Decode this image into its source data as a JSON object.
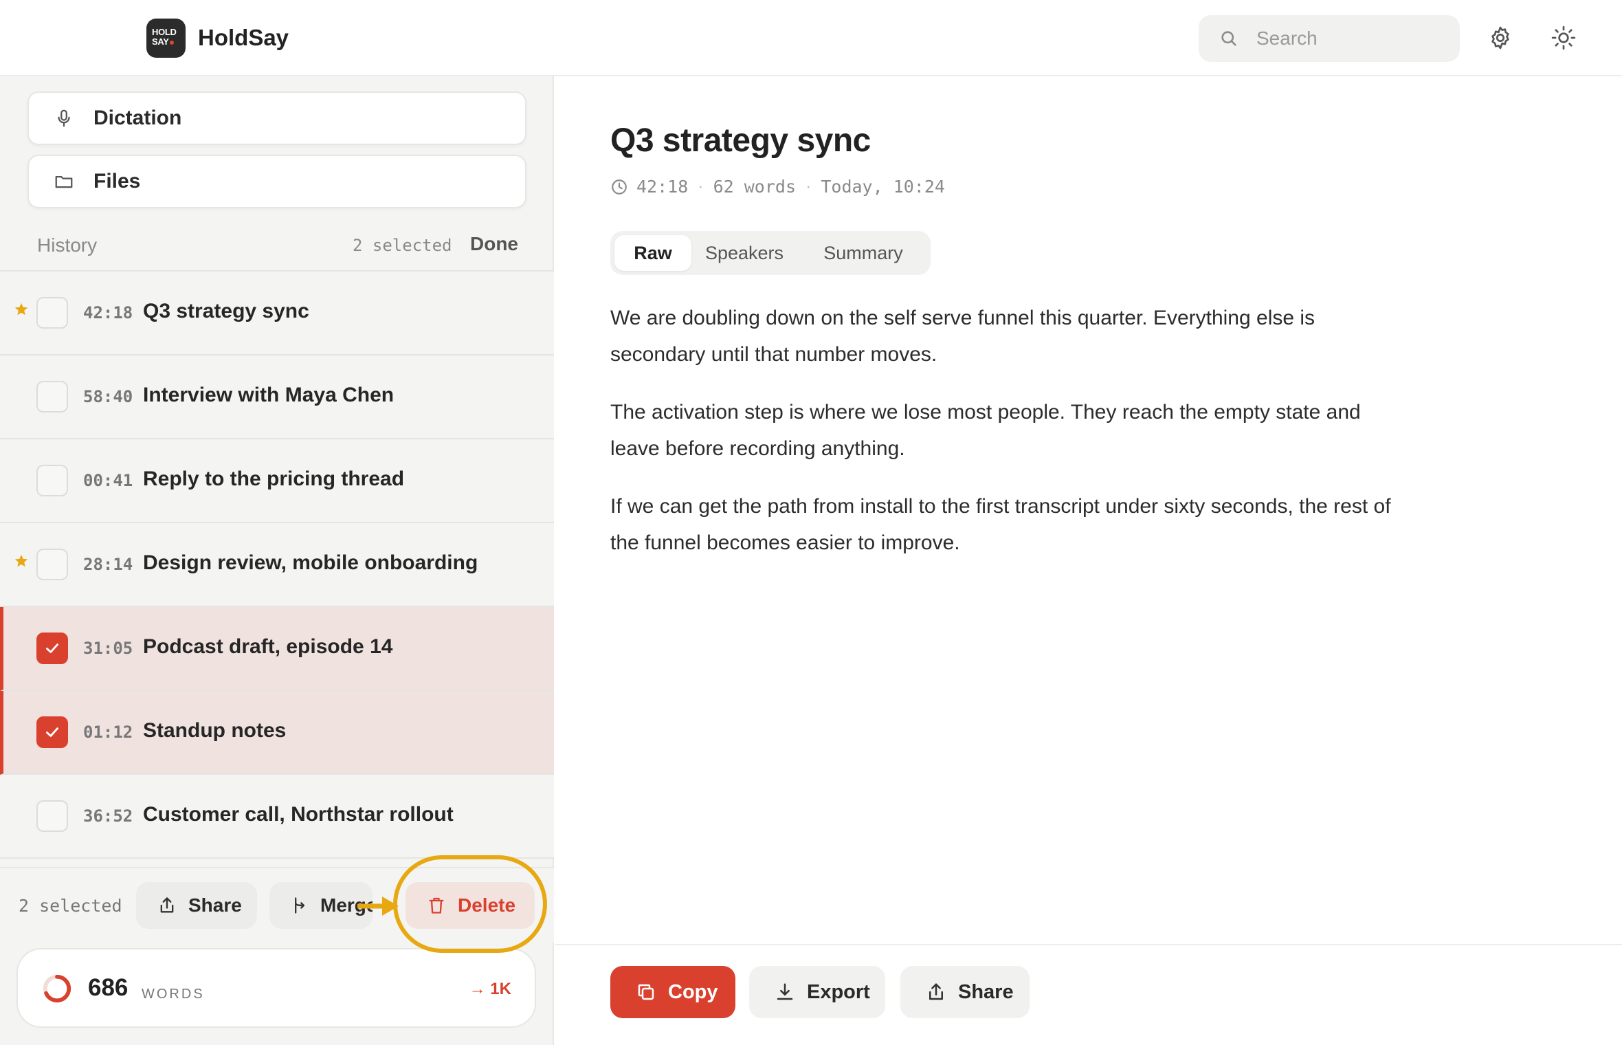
{
  "app": {
    "name": "HoldSay",
    "logo_text_1": "HOLD",
    "logo_text_2": "SAY"
  },
  "header": {
    "search_placeholder": "Search",
    "settings_icon": "gear-icon",
    "theme_icon": "sun-icon"
  },
  "sidebar": {
    "nav": [
      {
        "label": "Dictation",
        "icon": "microphone-icon"
      },
      {
        "label": "Files",
        "icon": "folder-icon"
      }
    ],
    "history": {
      "title": "History",
      "selected_label": "2 selected",
      "done_label": "Done",
      "items": [
        {
          "duration": "42:18",
          "title": "Q3 strategy sync",
          "starred": true,
          "selected": false
        },
        {
          "duration": "58:40",
          "title": "Interview with Maya Chen",
          "starred": false,
          "selected": false
        },
        {
          "duration": "00:41",
          "title": "Reply to the pricing thread",
          "starred": false,
          "selected": false
        },
        {
          "duration": "28:14",
          "title": "Design review, mobile onboarding",
          "starred": true,
          "selected": false
        },
        {
          "duration": "31:05",
          "title": "Podcast draft, episode 14",
          "starred": false,
          "selected": true
        },
        {
          "duration": "01:12",
          "title": "Standup notes",
          "starred": false,
          "selected": true
        },
        {
          "duration": "36:52",
          "title": "Customer call, Northstar rollout",
          "starred": false,
          "selected": false
        }
      ]
    },
    "action_bar": {
      "count": "2 selected",
      "share": "Share",
      "merge": "Merge",
      "delete": "Delete"
    },
    "words": {
      "count": "686",
      "unit": "WORDS",
      "goal": "→ 1K",
      "progress": 0.686
    }
  },
  "main": {
    "title": "Q3 strategy sync",
    "meta": {
      "duration": "42:18",
      "words": "62 words",
      "date": "Today, 10:24"
    },
    "tabs": [
      "Raw",
      "Speakers",
      "Summary"
    ],
    "active_tab": "Raw",
    "paragraphs": [
      "We are doubling down on the self serve funnel this quarter. Everything else is secondary until that number moves.",
      "The activation step is where we lose most people. They reach the empty state and leave before recording anything.",
      "If we can get the path from install to the first transcript under sixty seconds, the rest of the funnel becomes easier to improve."
    ],
    "footer": {
      "copy": "Copy",
      "export": "Export",
      "share": "Share"
    }
  },
  "colors": {
    "accent": "#d9412e",
    "highlight": "#e8a812",
    "star": "#e8a812"
  }
}
